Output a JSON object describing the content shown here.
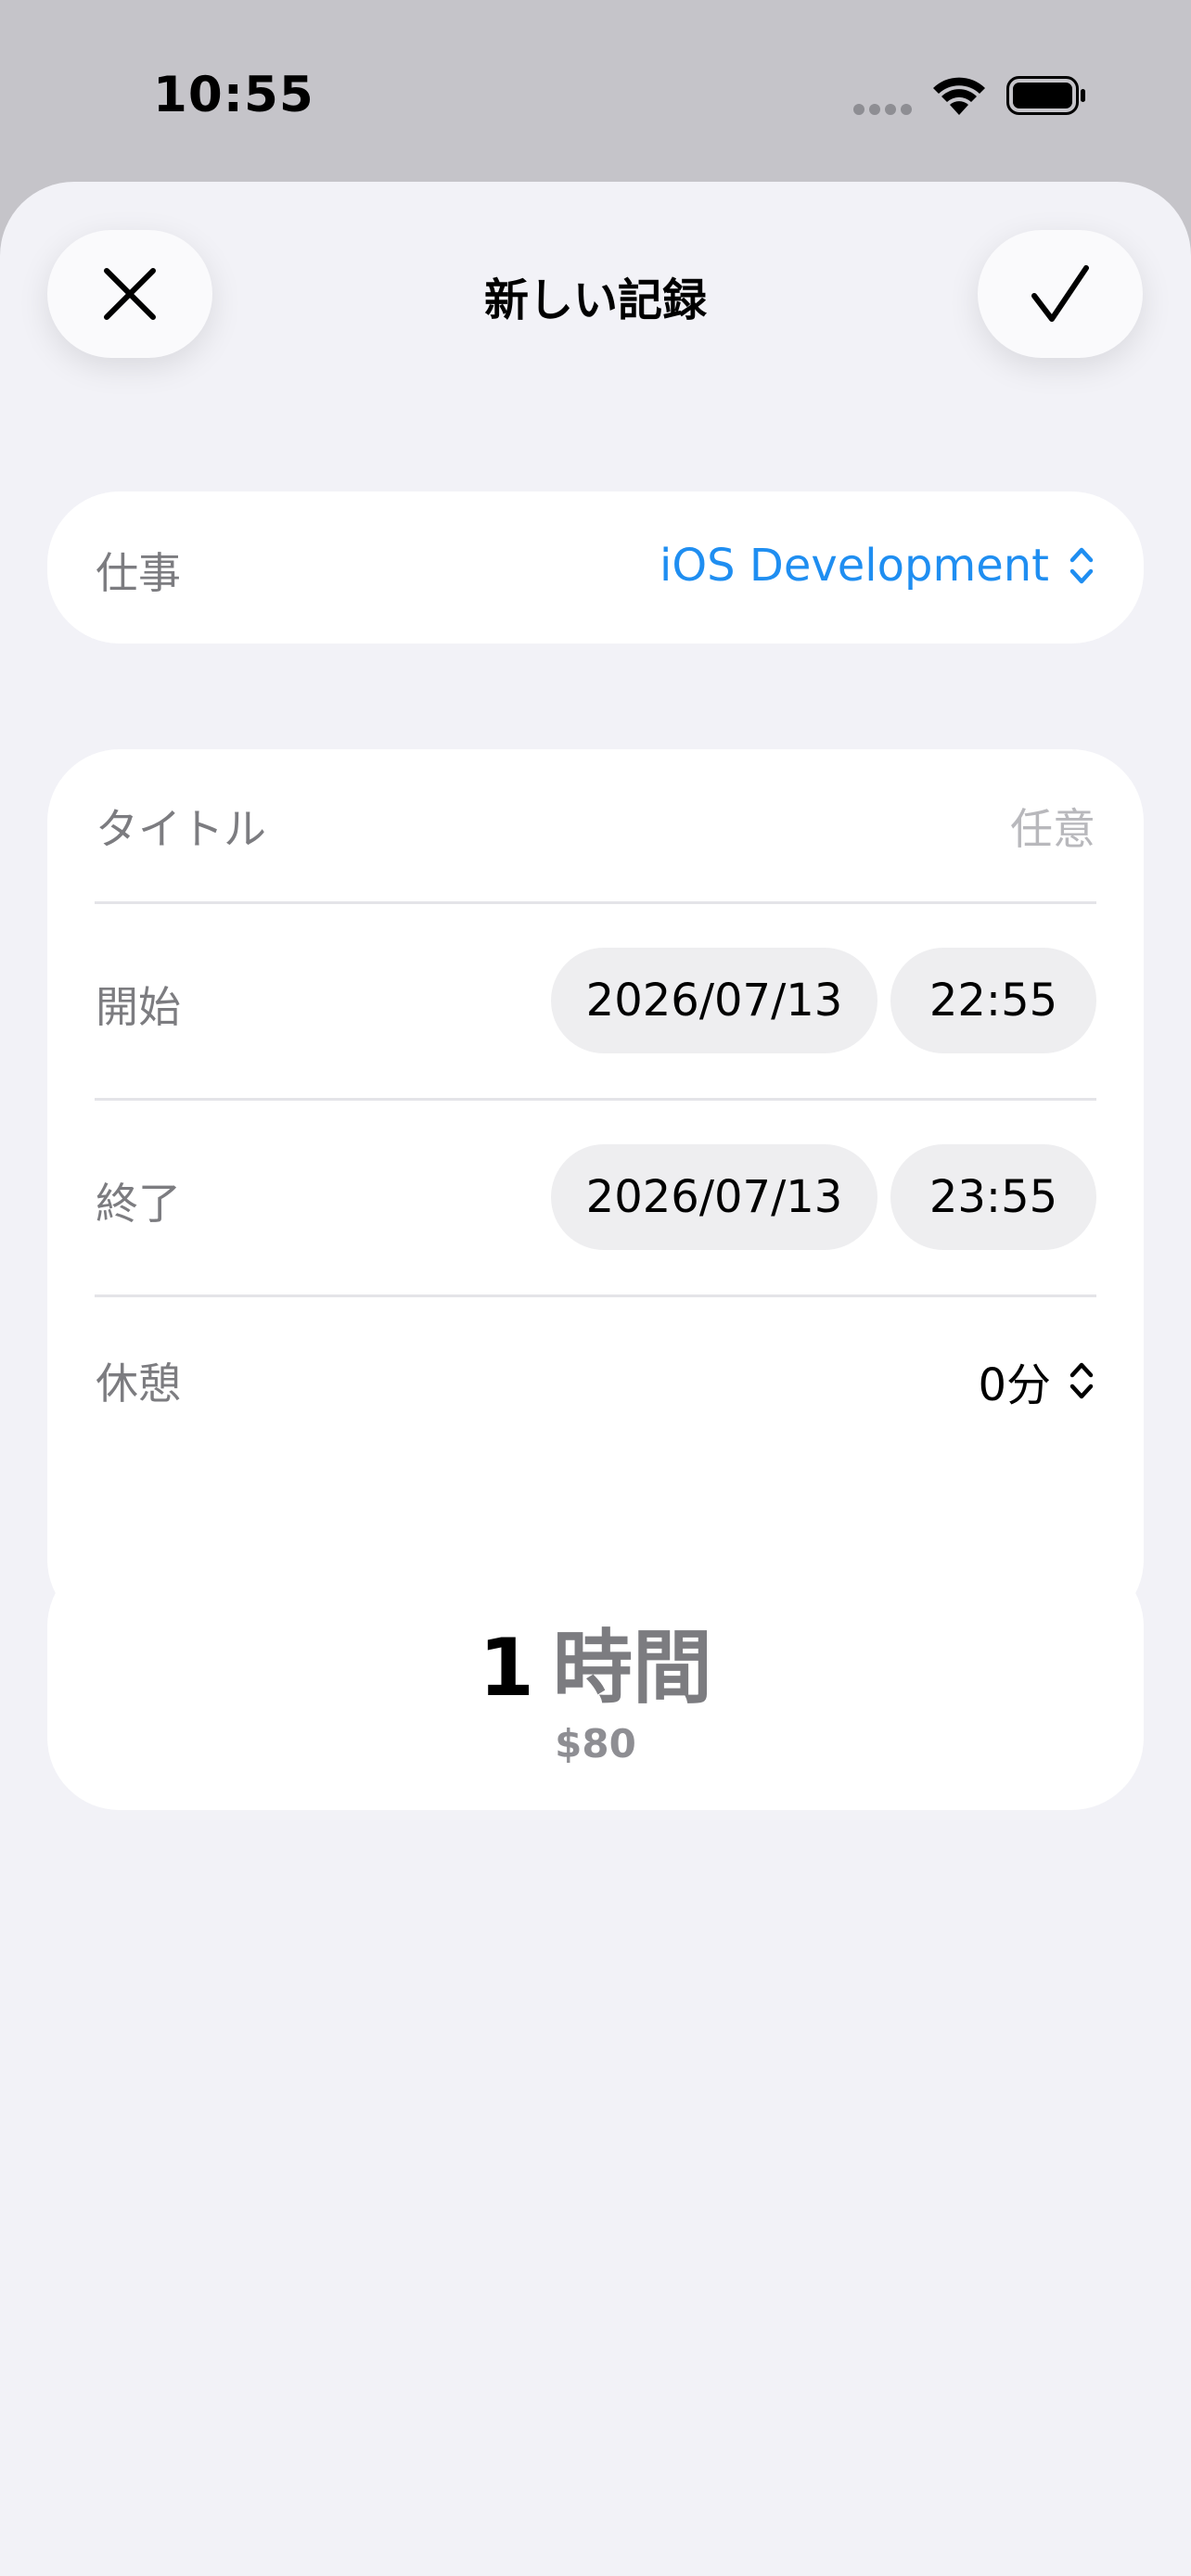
{
  "status_bar": {
    "time": "10:55",
    "icons": [
      "signal-dots-icon",
      "wifi-icon",
      "battery-icon"
    ]
  },
  "nav": {
    "title": "新しい記録",
    "close_icon": "close-icon",
    "confirm_icon": "checkmark-icon"
  },
  "job": {
    "label": "仕事",
    "value": "iOS Development",
    "accent_color": "#1f8ef1"
  },
  "form": {
    "title_label": "タイトル",
    "title_placeholder": "任意",
    "start_label": "開始",
    "start_date": "2026/07/13",
    "start_time": "22:55",
    "end_label": "終了",
    "end_date": "2026/07/13",
    "end_time": "23:55",
    "break_label": "休憩",
    "break_value": "0分"
  },
  "summary": {
    "duration_number": "1",
    "duration_unit": "時間",
    "earnings": "$80"
  }
}
